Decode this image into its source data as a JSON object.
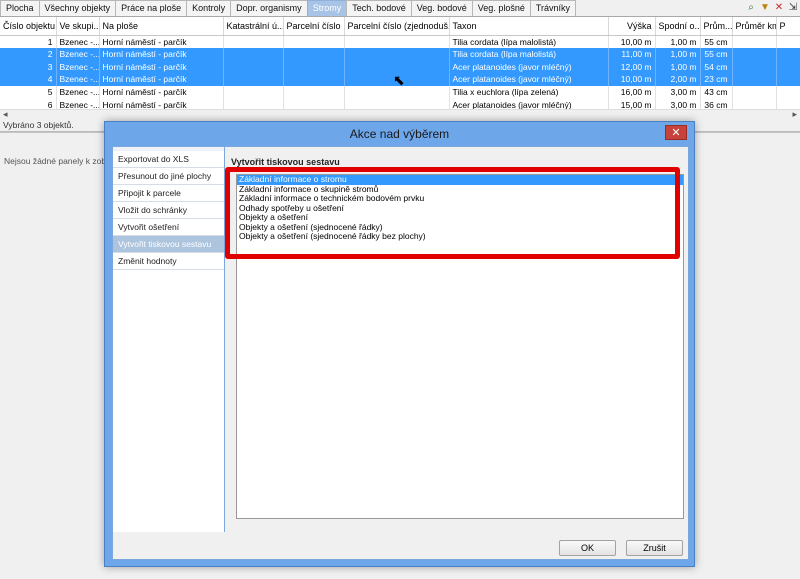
{
  "tabs": [
    "Plocha",
    "Všechny objekty",
    "Práce na ploše",
    "Kontroly",
    "Dopr. organismy",
    "Stromy",
    "Tech. bodové",
    "Veg. bodové",
    "Veg. plošné",
    "Trávníky"
  ],
  "active_tab": "Stromy",
  "grid": {
    "columns": [
      "Číslo objektu",
      "Ve skupi...",
      "Na ploše",
      "Katastrální ú...",
      "Parcelní číslo",
      "Parcelní číslo (zjednoduš...",
      "Taxon",
      "Výška",
      "Spodní o...",
      "Prům...",
      "Průměr kme...",
      "P"
    ],
    "rows": [
      {
        "id": "1",
        "skupina": "Bzenec -...",
        "plocha": "Horní náměstí - parčík",
        "katastr": "",
        "parcela": "",
        "parcela_zj": "",
        "taxon": "Tilia cordata (lípa malolistá)",
        "vyska": "10,00 m",
        "spodni": "1,00 m",
        "prumer": "55 cm",
        "selected": false
      },
      {
        "id": "2",
        "skupina": "Bzenec -...",
        "plocha": "Horní náměstí - parčík",
        "katastr": "",
        "parcela": "",
        "parcela_zj": "",
        "taxon": "Tilia cordata (lípa malolistá)",
        "vyska": "11,00 m",
        "spodni": "1,00 m",
        "prumer": "55 cm",
        "selected": true
      },
      {
        "id": "3",
        "skupina": "Bzenec -...",
        "plocha": "Horní náměstí - parčík",
        "katastr": "",
        "parcela": "",
        "parcela_zj": "",
        "taxon": "Acer platanoides (javor mléčný)",
        "vyska": "12,00 m",
        "spodni": "1,00 m",
        "prumer": "54 cm",
        "selected": true
      },
      {
        "id": "4",
        "skupina": "Bzenec -...",
        "plocha": "Horní náměstí - parčík",
        "katastr": "",
        "parcela": "",
        "parcela_zj": "",
        "taxon": "Acer platanoides (javor mléčný)",
        "vyska": "10,00 m",
        "spodni": "2,00 m",
        "prumer": "23 cm",
        "selected": true
      },
      {
        "id": "5",
        "skupina": "Bzenec -...",
        "plocha": "Horní náměstí - parčík",
        "katastr": "",
        "parcela": "",
        "parcela_zj": "",
        "taxon": "Tilia x euchlora (lípa zelená)",
        "vyska": "16,00 m",
        "spodni": "3,00 m",
        "prumer": "43 cm",
        "selected": false
      },
      {
        "id": "6",
        "skupina": "Bzenec -...",
        "plocha": "Horní náměstí - parčík",
        "katastr": "",
        "parcela": "",
        "parcela_zj": "",
        "taxon": "Acer platanoides (javor mléčný)",
        "vyska": "15,00 m",
        "spodni": "3,00 m",
        "prumer": "36 cm",
        "selected": false
      }
    ]
  },
  "status": "Vybráno 3 objektů.",
  "lower_panel_text": "Nejsou žádné panely k zobra",
  "dialog": {
    "title": "Akce nad výběrem",
    "menu": [
      "Exportovat do XLS",
      "Přesunout do jiné plochy",
      "Připojit k parcele",
      "Vložit do schránky",
      "Vytvořit ošetření",
      "Vytvořit tiskovou sestavu",
      "Změnit hodnoty"
    ],
    "active_menu": "Vytvořit tiskovou sestavu",
    "section_title": "Vytvořit tiskovou sestavu",
    "reports": [
      "Základní informace o stromu",
      "Základní informace o skupině stromů",
      "Základní informace o technickém bodovém prvku",
      "Odhady spotřeby u ošetření",
      "Objekty a ošetření",
      "Objekty a ošetření (sjednocené řádky)",
      "Objekty a ošetření (sjednocené řádky bez plochy)"
    ],
    "selected_report": "Základní informace o stromu",
    "ok_label": "OK",
    "cancel_label": "Zrušit",
    "close_glyph": "✕"
  },
  "colors": {
    "selection": "#3399ff",
    "dialog_frame": "#6ea6ea",
    "highlight": "#e00000"
  }
}
